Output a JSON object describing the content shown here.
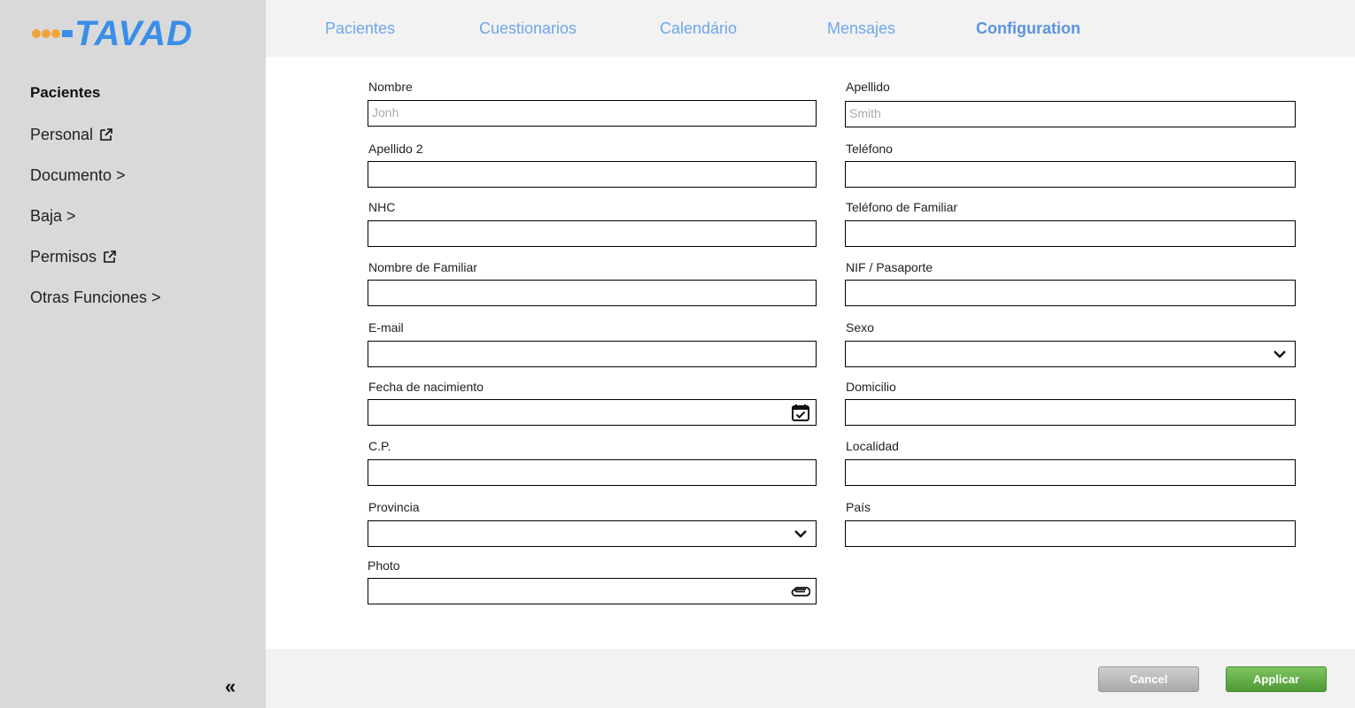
{
  "brand": {
    "logo_text": "TAVAD"
  },
  "topnav": {
    "tabs": [
      {
        "label": "Pacientes"
      },
      {
        "label": "Cuestionarios"
      },
      {
        "label": "Calendário"
      },
      {
        "label": "Mensajes"
      },
      {
        "label": "Configuration",
        "active": true
      }
    ]
  },
  "sidebar": {
    "header": "Pacientes",
    "items": [
      {
        "label": "Personal",
        "icon": "external-link-icon"
      },
      {
        "label": "Documento >"
      },
      {
        "label": "Baja >"
      },
      {
        "label": "Permisos",
        "icon": "external-link-icon"
      },
      {
        "label": "Otras Funciones >"
      }
    ],
    "collapse_icon": "«"
  },
  "form": {
    "nombre": {
      "label": "Nombre",
      "placeholder": "Jonh"
    },
    "apellido": {
      "label": "Apellido",
      "placeholder": "Smith"
    },
    "apellido2": {
      "label": "Apellido 2"
    },
    "telefono": {
      "label": "Teléfono"
    },
    "nhc": {
      "label": "NHC"
    },
    "telefono_familiar": {
      "label": "Teléfono de Familiar"
    },
    "nombre_familiar": {
      "label": "Nombre de Familiar"
    },
    "nif": {
      "label": "NIF / Pasaporte"
    },
    "email": {
      "label": "E-mail"
    },
    "sexo": {
      "label": "Sexo"
    },
    "fecha": {
      "label": "Fecha de nacimiento"
    },
    "domicilio": {
      "label": "Domicilio"
    },
    "cp": {
      "label": "C.P."
    },
    "localidad": {
      "label": "Localidad"
    },
    "provincia": {
      "label": "Provincia"
    },
    "pais": {
      "label": "País"
    },
    "photo": {
      "label": "Photo"
    }
  },
  "footer": {
    "cancel_label": "Cancel",
    "apply_label": "Applicar"
  },
  "colors": {
    "accent": "#5b94e0",
    "sidebar_bg": "#d9d9d9",
    "apply_green": "#5ba940"
  }
}
